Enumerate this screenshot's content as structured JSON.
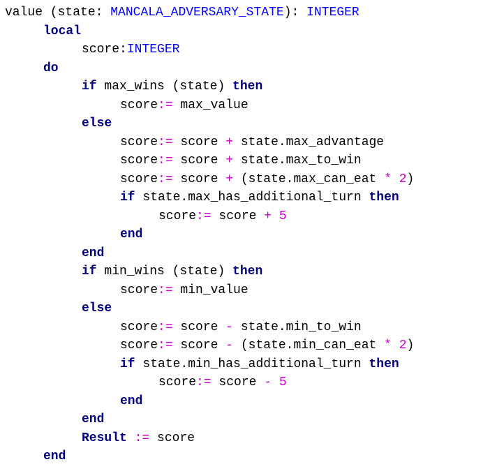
{
  "colors": {
    "background": "#ffffff",
    "identifier": "#000000",
    "keyword": "#000080",
    "type": "#0000ff",
    "operator": "#cc00cc"
  },
  "code": {
    "lines": [
      {
        "indent": 0,
        "tokens": [
          {
            "k": "id",
            "t": "value (state: "
          },
          {
            "k": "type",
            "t": "MANCALA_ADVERSARY_STATE"
          },
          {
            "k": "id",
            "t": "): "
          },
          {
            "k": "type",
            "t": "INTEGER"
          }
        ]
      },
      {
        "indent": 1,
        "tokens": [
          {
            "k": "kw",
            "t": "local"
          }
        ]
      },
      {
        "indent": 2,
        "tokens": [
          {
            "k": "id",
            "t": "score:"
          },
          {
            "k": "type",
            "t": "INTEGER"
          }
        ]
      },
      {
        "indent": 1,
        "tokens": [
          {
            "k": "kw",
            "t": "do"
          }
        ]
      },
      {
        "indent": 2,
        "tokens": [
          {
            "k": "kw",
            "t": "if"
          },
          {
            "k": "id",
            "t": " max_wins (state) "
          },
          {
            "k": "kw",
            "t": "then"
          }
        ]
      },
      {
        "indent": 3,
        "tokens": [
          {
            "k": "id",
            "t": "score"
          },
          {
            "k": "op",
            "t": ":="
          },
          {
            "k": "id",
            "t": " max_value"
          }
        ]
      },
      {
        "indent": 2,
        "tokens": [
          {
            "k": "kw",
            "t": "else"
          }
        ]
      },
      {
        "indent": 3,
        "tokens": [
          {
            "k": "id",
            "t": "score"
          },
          {
            "k": "op",
            "t": ":="
          },
          {
            "k": "id",
            "t": " score "
          },
          {
            "k": "op",
            "t": "+"
          },
          {
            "k": "id",
            "t": " state.max_advantage"
          }
        ]
      },
      {
        "indent": 3,
        "tokens": [
          {
            "k": "id",
            "t": "score"
          },
          {
            "k": "op",
            "t": ":="
          },
          {
            "k": "id",
            "t": " score "
          },
          {
            "k": "op",
            "t": "+"
          },
          {
            "k": "id",
            "t": " state.max_to_win"
          }
        ]
      },
      {
        "indent": 3,
        "tokens": [
          {
            "k": "id",
            "t": "score"
          },
          {
            "k": "op",
            "t": ":="
          },
          {
            "k": "id",
            "t": " score "
          },
          {
            "k": "op",
            "t": "+"
          },
          {
            "k": "id",
            "t": " (state.max_can_eat "
          },
          {
            "k": "op",
            "t": "*"
          },
          {
            "k": "id",
            "t": " "
          },
          {
            "k": "num",
            "t": "2"
          },
          {
            "k": "id",
            "t": ")"
          }
        ]
      },
      {
        "indent": 3,
        "tokens": [
          {
            "k": "kw",
            "t": "if"
          },
          {
            "k": "id",
            "t": " state.max_has_additional_turn "
          },
          {
            "k": "kw",
            "t": "then"
          }
        ]
      },
      {
        "indent": 4,
        "tokens": [
          {
            "k": "id",
            "t": "score"
          },
          {
            "k": "op",
            "t": ":="
          },
          {
            "k": "id",
            "t": " score "
          },
          {
            "k": "op",
            "t": "+"
          },
          {
            "k": "id",
            "t": " "
          },
          {
            "k": "num",
            "t": "5"
          }
        ]
      },
      {
        "indent": 3,
        "tokens": [
          {
            "k": "kw",
            "t": "end"
          }
        ]
      },
      {
        "indent": 2,
        "tokens": [
          {
            "k": "kw",
            "t": "end"
          }
        ]
      },
      {
        "indent": 2,
        "tokens": [
          {
            "k": "kw",
            "t": "if"
          },
          {
            "k": "id",
            "t": " min_wins (state) "
          },
          {
            "k": "kw",
            "t": "then"
          }
        ]
      },
      {
        "indent": 3,
        "tokens": [
          {
            "k": "id",
            "t": "score"
          },
          {
            "k": "op",
            "t": ":="
          },
          {
            "k": "id",
            "t": " min_value"
          }
        ]
      },
      {
        "indent": 2,
        "tokens": [
          {
            "k": "kw",
            "t": "else"
          }
        ]
      },
      {
        "indent": 3,
        "tokens": [
          {
            "k": "id",
            "t": "score"
          },
          {
            "k": "op",
            "t": ":="
          },
          {
            "k": "id",
            "t": " score "
          },
          {
            "k": "op",
            "t": "-"
          },
          {
            "k": "id",
            "t": " state.min_to_win"
          }
        ]
      },
      {
        "indent": 3,
        "tokens": [
          {
            "k": "id",
            "t": "score"
          },
          {
            "k": "op",
            "t": ":="
          },
          {
            "k": "id",
            "t": " score "
          },
          {
            "k": "op",
            "t": "-"
          },
          {
            "k": "id",
            "t": " (state.min_can_eat "
          },
          {
            "k": "op",
            "t": "*"
          },
          {
            "k": "id",
            "t": " "
          },
          {
            "k": "num",
            "t": "2"
          },
          {
            "k": "id",
            "t": ")"
          }
        ]
      },
      {
        "indent": 3,
        "tokens": [
          {
            "k": "kw",
            "t": "if"
          },
          {
            "k": "id",
            "t": " state.min_has_additional_turn "
          },
          {
            "k": "kw",
            "t": "then"
          }
        ]
      },
      {
        "indent": 4,
        "tokens": [
          {
            "k": "id",
            "t": "score"
          },
          {
            "k": "op",
            "t": ":="
          },
          {
            "k": "id",
            "t": " score "
          },
          {
            "k": "op",
            "t": "-"
          },
          {
            "k": "id",
            "t": " "
          },
          {
            "k": "num",
            "t": "5"
          }
        ]
      },
      {
        "indent": 3,
        "tokens": [
          {
            "k": "kw",
            "t": "end"
          }
        ]
      },
      {
        "indent": 2,
        "tokens": [
          {
            "k": "kw",
            "t": "end"
          }
        ]
      },
      {
        "indent": 2,
        "tokens": [
          {
            "k": "kw",
            "t": "Result"
          },
          {
            "k": "id",
            "t": " "
          },
          {
            "k": "op",
            "t": ":="
          },
          {
            "k": "id",
            "t": " score"
          }
        ]
      },
      {
        "indent": 1,
        "tokens": [
          {
            "k": "kw",
            "t": "end"
          }
        ]
      }
    ]
  }
}
